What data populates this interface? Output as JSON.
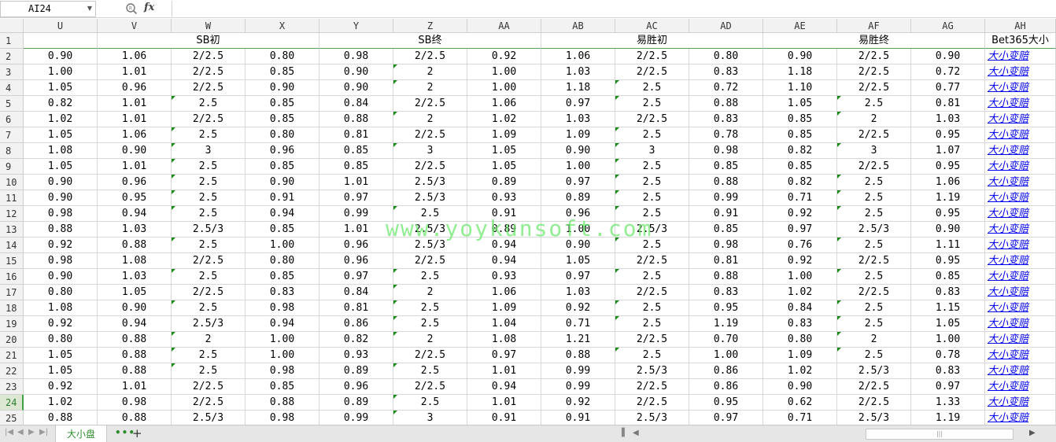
{
  "formula_bar": {
    "cell_ref": "AI24",
    "fx_label": "fx",
    "formula": ""
  },
  "columns": [
    "U",
    "V",
    "W",
    "X",
    "Y",
    "Z",
    "AA",
    "AB",
    "AC",
    "AD",
    "AE",
    "AF",
    "AG",
    "AH"
  ],
  "header_row": {
    "row_number": "1",
    "groups": [
      "SB初",
      "SB终",
      "易胜初",
      "易胜终"
    ],
    "last_header": "Bet365大小"
  },
  "rows": [
    {
      "n": "2",
      "cells": [
        "0.90",
        "1.06",
        "2/2.5",
        "0.80",
        "0.98",
        "2/2.5",
        "0.92",
        "1.06",
        "2/2.5",
        "0.80",
        "0.90",
        "2/2.5",
        "0.90"
      ],
      "marks": []
    },
    {
      "n": "3",
      "cells": [
        "1.00",
        "1.01",
        "2/2.5",
        "0.85",
        "0.90",
        "2",
        "1.00",
        "1.03",
        "2/2.5",
        "0.83",
        "1.18",
        "2/2.5",
        "0.72"
      ],
      "marks": [
        5
      ]
    },
    {
      "n": "4",
      "cells": [
        "1.05",
        "0.96",
        "2/2.5",
        "0.90",
        "0.90",
        "2",
        "1.00",
        "1.18",
        "2.5",
        "0.72",
        "1.10",
        "2/2.5",
        "0.77"
      ],
      "marks": [
        5,
        8
      ]
    },
    {
      "n": "5",
      "cells": [
        "0.82",
        "1.01",
        "2.5",
        "0.85",
        "0.84",
        "2/2.5",
        "1.06",
        "0.97",
        "2.5",
        "0.88",
        "1.05",
        "2.5",
        "0.81"
      ],
      "marks": [
        2,
        8,
        11
      ]
    },
    {
      "n": "6",
      "cells": [
        "1.02",
        "1.01",
        "2/2.5",
        "0.85",
        "0.88",
        "2",
        "1.02",
        "1.03",
        "2/2.5",
        "0.83",
        "0.85",
        "2",
        "1.03"
      ],
      "marks": [
        5,
        11
      ]
    },
    {
      "n": "7",
      "cells": [
        "1.05",
        "1.06",
        "2.5",
        "0.80",
        "0.81",
        "2/2.5",
        "1.09",
        "1.09",
        "2.5",
        "0.78",
        "0.85",
        "2/2.5",
        "0.95"
      ],
      "marks": [
        2,
        8
      ]
    },
    {
      "n": "8",
      "cells": [
        "1.08",
        "0.90",
        "3",
        "0.96",
        "0.85",
        "3",
        "1.05",
        "0.90",
        "3",
        "0.98",
        "0.82",
        "3",
        "1.07"
      ],
      "marks": [
        2,
        5,
        8,
        11
      ]
    },
    {
      "n": "9",
      "cells": [
        "1.05",
        "1.01",
        "2.5",
        "0.85",
        "0.85",
        "2/2.5",
        "1.05",
        "1.00",
        "2.5",
        "0.85",
        "0.85",
        "2/2.5",
        "0.95"
      ],
      "marks": [
        2,
        8
      ]
    },
    {
      "n": "10",
      "cells": [
        "0.90",
        "0.96",
        "2.5",
        "0.90",
        "1.01",
        "2.5/3",
        "0.89",
        "0.97",
        "2.5",
        "0.88",
        "0.82",
        "2.5",
        "1.06"
      ],
      "marks": [
        2,
        8,
        11
      ]
    },
    {
      "n": "11",
      "cells": [
        "0.90",
        "0.95",
        "2.5",
        "0.91",
        "0.97",
        "2.5/3",
        "0.93",
        "0.89",
        "2.5",
        "0.99",
        "0.71",
        "2.5",
        "1.19"
      ],
      "marks": [
        2,
        8,
        11
      ]
    },
    {
      "n": "12",
      "cells": [
        "0.98",
        "0.94",
        "2.5",
        "0.94",
        "0.99",
        "2.5",
        "0.91",
        "0.96",
        "2.5",
        "0.91",
        "0.92",
        "2.5",
        "0.95"
      ],
      "marks": [
        2,
        5,
        8,
        11
      ]
    },
    {
      "n": "13",
      "cells": [
        "0.88",
        "1.03",
        "2.5/3",
        "0.85",
        "1.01",
        "2.5/3",
        "0.89",
        "1.00",
        "2.5/3",
        "0.85",
        "0.97",
        "2.5/3",
        "0.90"
      ],
      "marks": []
    },
    {
      "n": "14",
      "cells": [
        "0.92",
        "0.88",
        "2.5",
        "1.00",
        "0.96",
        "2.5/3",
        "0.94",
        "0.90",
        "2.5",
        "0.98",
        "0.76",
        "2.5",
        "1.11"
      ],
      "marks": [
        2,
        8,
        11
      ]
    },
    {
      "n": "15",
      "cells": [
        "0.98",
        "1.08",
        "2/2.5",
        "0.80",
        "0.96",
        "2/2.5",
        "0.94",
        "1.05",
        "2/2.5",
        "0.81",
        "0.92",
        "2/2.5",
        "0.95"
      ],
      "marks": []
    },
    {
      "n": "16",
      "cells": [
        "0.90",
        "1.03",
        "2.5",
        "0.85",
        "0.97",
        "2.5",
        "0.93",
        "0.97",
        "2.5",
        "0.88",
        "1.00",
        "2.5",
        "0.85"
      ],
      "marks": [
        2,
        5,
        8,
        11
      ]
    },
    {
      "n": "17",
      "cells": [
        "0.80",
        "1.05",
        "2/2.5",
        "0.83",
        "0.84",
        "2",
        "1.06",
        "1.03",
        "2/2.5",
        "0.83",
        "1.02",
        "2/2.5",
        "0.83"
      ],
      "marks": [
        5
      ]
    },
    {
      "n": "18",
      "cells": [
        "1.08",
        "0.90",
        "2.5",
        "0.98",
        "0.81",
        "2.5",
        "1.09",
        "0.92",
        "2.5",
        "0.95",
        "0.84",
        "2.5",
        "1.15"
      ],
      "marks": [
        2,
        5,
        8,
        11
      ]
    },
    {
      "n": "19",
      "cells": [
        "0.92",
        "0.94",
        "2.5/3",
        "0.94",
        "0.86",
        "2.5",
        "1.04",
        "0.71",
        "2.5",
        "1.19",
        "0.83",
        "2.5",
        "1.05"
      ],
      "marks": [
        5,
        8,
        11
      ]
    },
    {
      "n": "20",
      "cells": [
        "0.80",
        "0.88",
        "2",
        "1.00",
        "0.82",
        "2",
        "1.08",
        "1.21",
        "2/2.5",
        "0.70",
        "0.80",
        "2",
        "1.00"
      ],
      "marks": [
        2,
        5,
        11
      ]
    },
    {
      "n": "21",
      "cells": [
        "1.05",
        "0.88",
        "2.5",
        "1.00",
        "0.93",
        "2/2.5",
        "0.97",
        "0.88",
        "2.5",
        "1.00",
        "1.09",
        "2.5",
        "0.78"
      ],
      "marks": [
        2,
        8,
        11
      ]
    },
    {
      "n": "22",
      "cells": [
        "1.05",
        "0.88",
        "2.5",
        "0.98",
        "0.89",
        "2.5",
        "1.01",
        "0.99",
        "2.5/3",
        "0.86",
        "1.02",
        "2.5/3",
        "0.83"
      ],
      "marks": [
        2,
        5
      ]
    },
    {
      "n": "23",
      "cells": [
        "0.92",
        "1.01",
        "2/2.5",
        "0.85",
        "0.96",
        "2/2.5",
        "0.94",
        "0.99",
        "2/2.5",
        "0.86",
        "0.90",
        "2/2.5",
        "0.97"
      ],
      "marks": []
    },
    {
      "n": "24",
      "cells": [
        "1.02",
        "0.98",
        "2/2.5",
        "0.88",
        "0.89",
        "2.5",
        "1.01",
        "0.92",
        "2/2.5",
        "0.95",
        "0.62",
        "2/2.5",
        "1.33"
      ],
      "marks": [
        5
      ]
    },
    {
      "n": "25",
      "cells": [
        "0.88",
        "0.88",
        "2.5/3",
        "0.98",
        "0.99",
        "3",
        "0.91",
        "0.91",
        "2.5/3",
        "0.97",
        "0.71",
        "2.5/3",
        "1.19"
      ],
      "marks": [
        5
      ]
    }
  ],
  "link_text": "大小变赔",
  "active_row": "24",
  "watermark": "www.yoykunsoft.com",
  "sheet_tab": "大小盘",
  "colors": {
    "accent_green": "#2e8b2e",
    "link_blue": "#0000ee",
    "header_gray": "#f2f2f2"
  }
}
